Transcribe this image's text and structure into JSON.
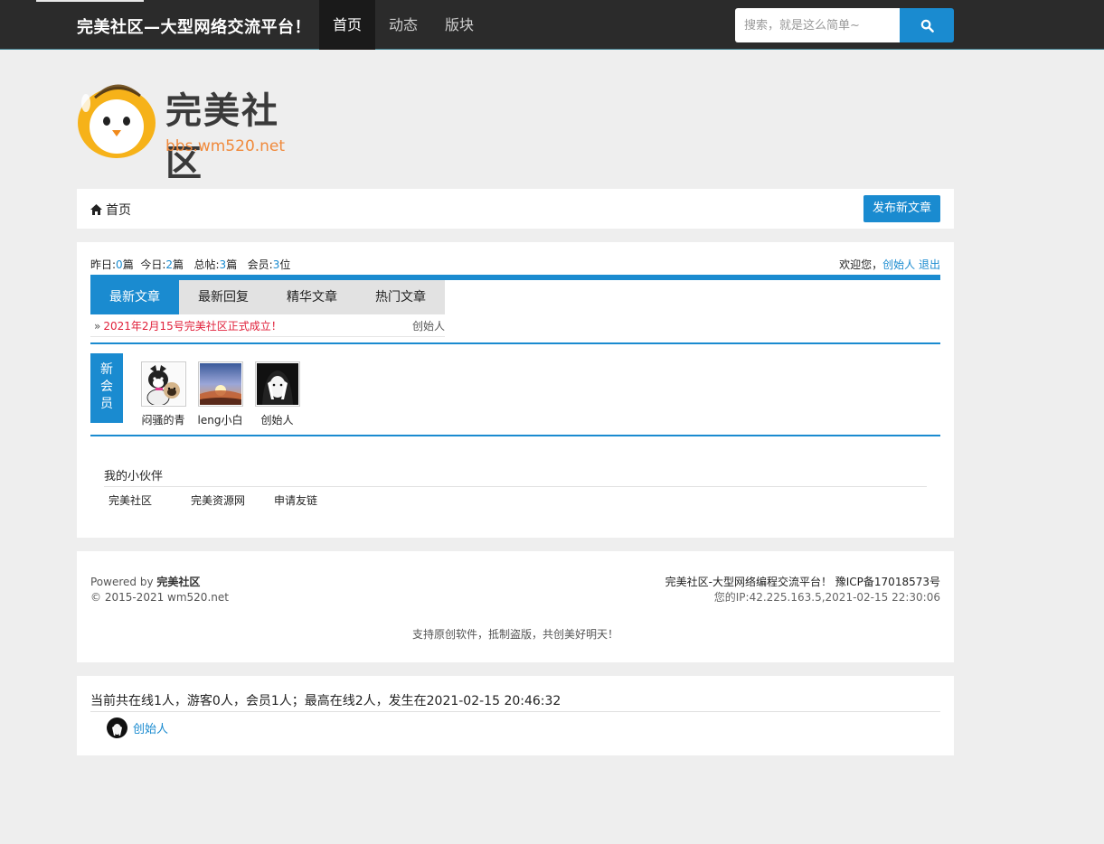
{
  "header": {
    "brand": "完美社区—大型网络交流平台！",
    "nav": [
      "首页",
      "动态",
      "版块"
    ],
    "search_placeholder": "搜索，就是这么简单~"
  },
  "logo": {
    "name_cn": "完美社区",
    "domain": "bbs.wm520.net"
  },
  "breadcrumb": {
    "home": "首页",
    "post_button": "发布新文章"
  },
  "stats": {
    "yesterday_label": "昨日:",
    "yesterday": "0",
    "today_label": "今日:",
    "today": "2",
    "total_label": "总帖:",
    "total": "3",
    "members_label": "会员:",
    "members": "3",
    "unit_posts": "篇",
    "unit_members": "位"
  },
  "welcome": {
    "text": "欢迎您，",
    "user": "创始人",
    "logout": "退出"
  },
  "tabs": [
    "最新文章",
    "最新回复",
    "精华文章",
    "热门文章"
  ],
  "articles": [
    {
      "bullet": "»",
      "title": "2021年2月15号完美社区正式成立！",
      "author": "创始人"
    }
  ],
  "new_members": {
    "label": "新会员",
    "members": [
      {
        "name": "闷骚的青"
      },
      {
        "name": "leng小白"
      },
      {
        "name": "创始人"
      }
    ]
  },
  "friends": {
    "title": "我的小伙伴",
    "links": [
      "完美社区",
      "完美资源网",
      "申请友链"
    ]
  },
  "footer": {
    "powered_prefix": "Powered by ",
    "powered_name": "完美社区",
    "copyright": "© 2015-2021 wm520.net",
    "site_desc": "完美社区-大型网络编程交流平台！ 豫ICP备17018573号",
    "ip_info": "您的IP:42.225.163.5,2021-02-15 22:30:06",
    "slogan": "支持原创软件，抵制盗版，共创美好明天！"
  },
  "online": {
    "summary": "当前共在线1人，游客0人，会员1人；最高在线2人，发生在2021-02-15 20:46:32",
    "users": [
      {
        "name": "创始人"
      }
    ]
  },
  "colors": {
    "accent": "#1a8bd0",
    "topbar": "#2b2b2b",
    "article_title": "#e0203a",
    "logo_domain": "#f08a3c"
  }
}
